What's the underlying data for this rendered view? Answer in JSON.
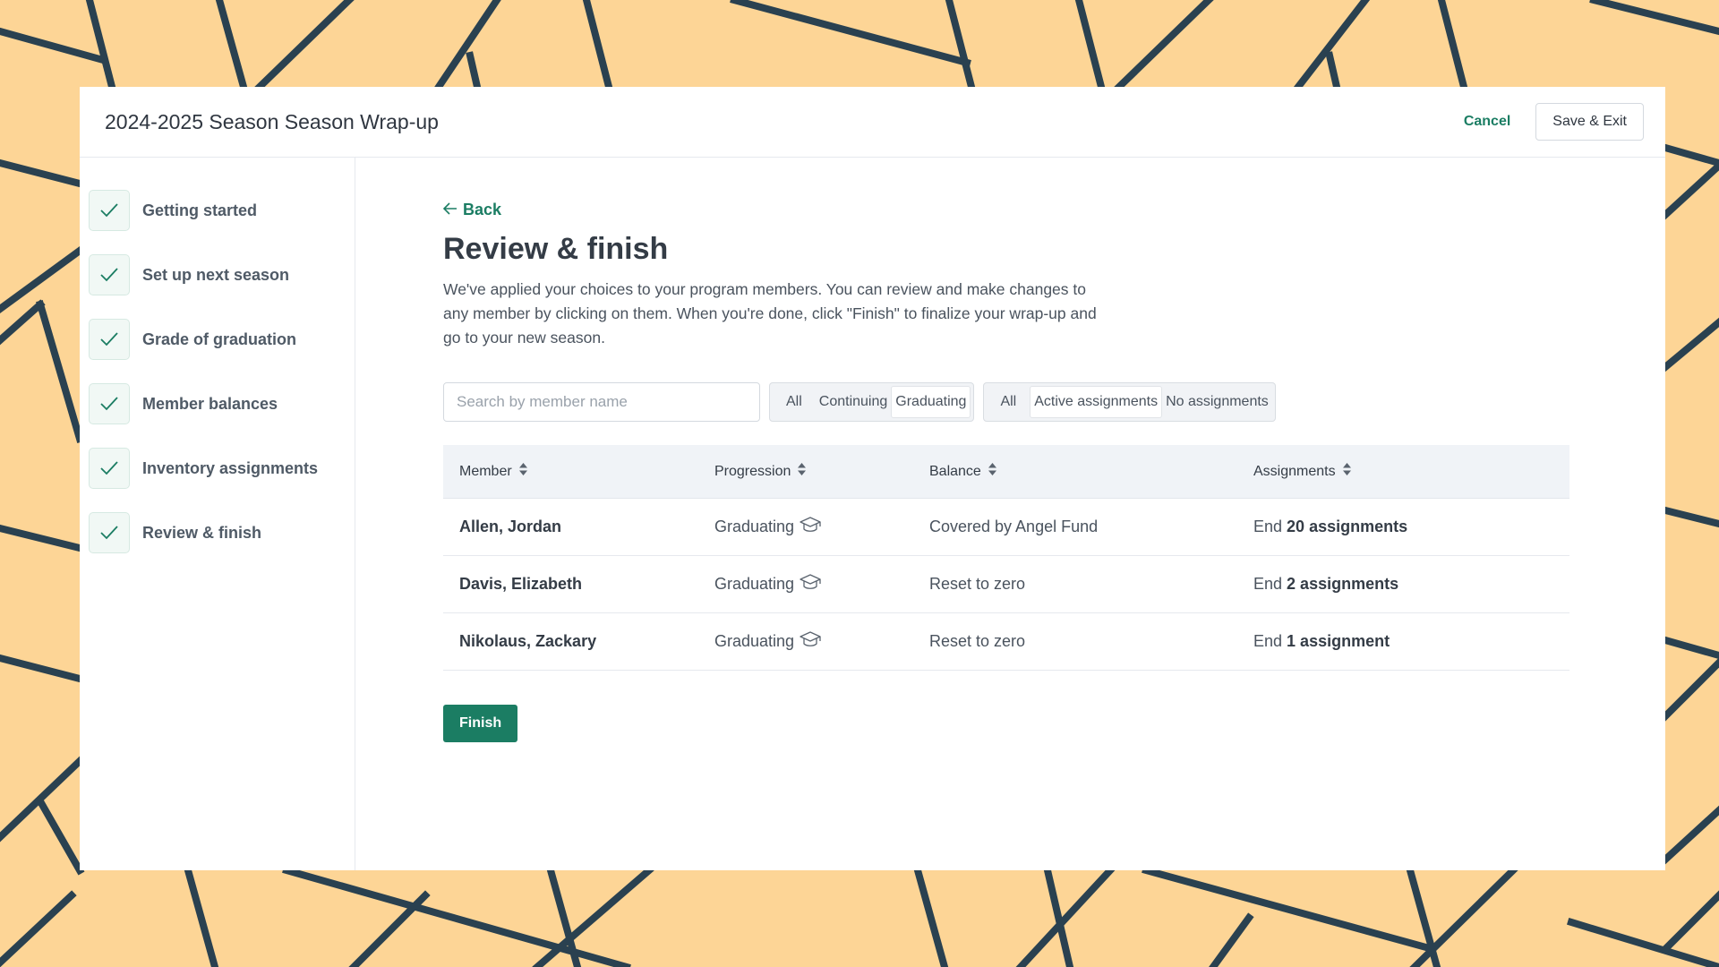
{
  "header": {
    "title": "2024-2025 Season Season Wrap-up",
    "cancel_label": "Cancel",
    "save_label": "Save & Exit"
  },
  "sidebar": {
    "steps": [
      {
        "label": "Getting started"
      },
      {
        "label": "Set up next season"
      },
      {
        "label": "Grade of graduation"
      },
      {
        "label": "Member balances"
      },
      {
        "label": "Inventory assignments"
      },
      {
        "label": "Review & finish"
      }
    ]
  },
  "main": {
    "back_label": "Back",
    "title": "Review & finish",
    "description": "We've applied your choices to your program members. You can review and make changes to any member by clicking on them. When you're done, click \"Finish\" to finalize your wrap-up and go to your new season.",
    "search_placeholder": "Search by member name",
    "progression_filter": {
      "options": [
        "All",
        "Continuing",
        "Graduating"
      ],
      "selected": "Graduating"
    },
    "assignment_filter": {
      "options": [
        "All",
        "Active assignments",
        "No assignments"
      ],
      "selected": "Active assignments"
    },
    "table": {
      "columns": [
        "Member",
        "Progression",
        "Balance",
        "Assignments"
      ],
      "rows": [
        {
          "member": "Allen, Jordan",
          "progression": "Graduating",
          "balance": "Covered by Angel Fund",
          "assign_prefix": "End",
          "assign_count": "20 assignments"
        },
        {
          "member": "Davis, Elizabeth",
          "progression": "Graduating",
          "balance": "Reset to zero",
          "assign_prefix": "End",
          "assign_count": "2 assignments"
        },
        {
          "member": "Nikolaus, Zackary",
          "progression": "Graduating",
          "balance": "Reset to zero",
          "assign_prefix": "End",
          "assign_count": "1 assignment"
        }
      ]
    },
    "finish_label": "Finish"
  },
  "colors": {
    "background": "#fdd596",
    "pattern_lines": "#2a4150",
    "accent": "#1b7d63"
  },
  "icons": {
    "step_status": "check-icon",
    "back": "arrow-left-icon",
    "sort": "sort-icon",
    "progression": "graduation-cap-icon"
  }
}
